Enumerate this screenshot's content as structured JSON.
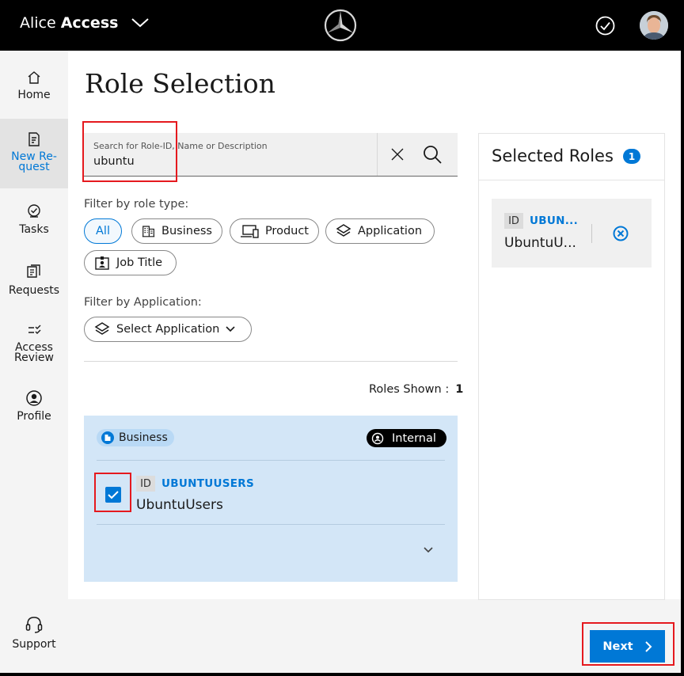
{
  "app": {
    "name_light": "Alice",
    "name_bold": "Access"
  },
  "sidebar": {
    "items": [
      {
        "label": "Home",
        "icon": "home-icon"
      },
      {
        "label": "New Re-\nquest",
        "icon": "new-request-icon"
      },
      {
        "label": "Tasks",
        "icon": "tasks-icon"
      },
      {
        "label": "Requests",
        "icon": "requests-icon"
      },
      {
        "label": "Access\nReview",
        "icon": "access-review-icon"
      },
      {
        "label": "Profile",
        "icon": "profile-icon"
      },
      {
        "label": "Support",
        "icon": "headset-icon"
      }
    ],
    "active": "New Request"
  },
  "page": {
    "title": "Role Selection"
  },
  "search": {
    "placeholder": "Search for Role-ID, Name or Description",
    "value": "ubuntu"
  },
  "filters": {
    "role_type_label": "Filter by role type:",
    "role_types": [
      "All",
      "Business",
      "Product",
      "Application",
      "Job Title"
    ],
    "selected_role_type": "All",
    "application_label": "Filter by Application:",
    "application_select": "Select Application"
  },
  "results": {
    "shown_label": "Roles Shown :",
    "shown_count": "1",
    "roles": [
      {
        "type": "Business",
        "classification": "Internal",
        "id_tag": "ID",
        "id": "UBUNTUUSERS",
        "name": "UbuntuUsers",
        "checked": true
      }
    ]
  },
  "selected": {
    "title": "Selected Roles",
    "count": "1",
    "items": [
      {
        "id_tag": "ID",
        "id": "UBUN...",
        "name": "UbuntuU..."
      }
    ]
  },
  "footer": {
    "next_label": "Next"
  },
  "colors": {
    "accent": "#0078d6",
    "card_bg": "#d3e6f7",
    "highlight": "#e5191e"
  }
}
